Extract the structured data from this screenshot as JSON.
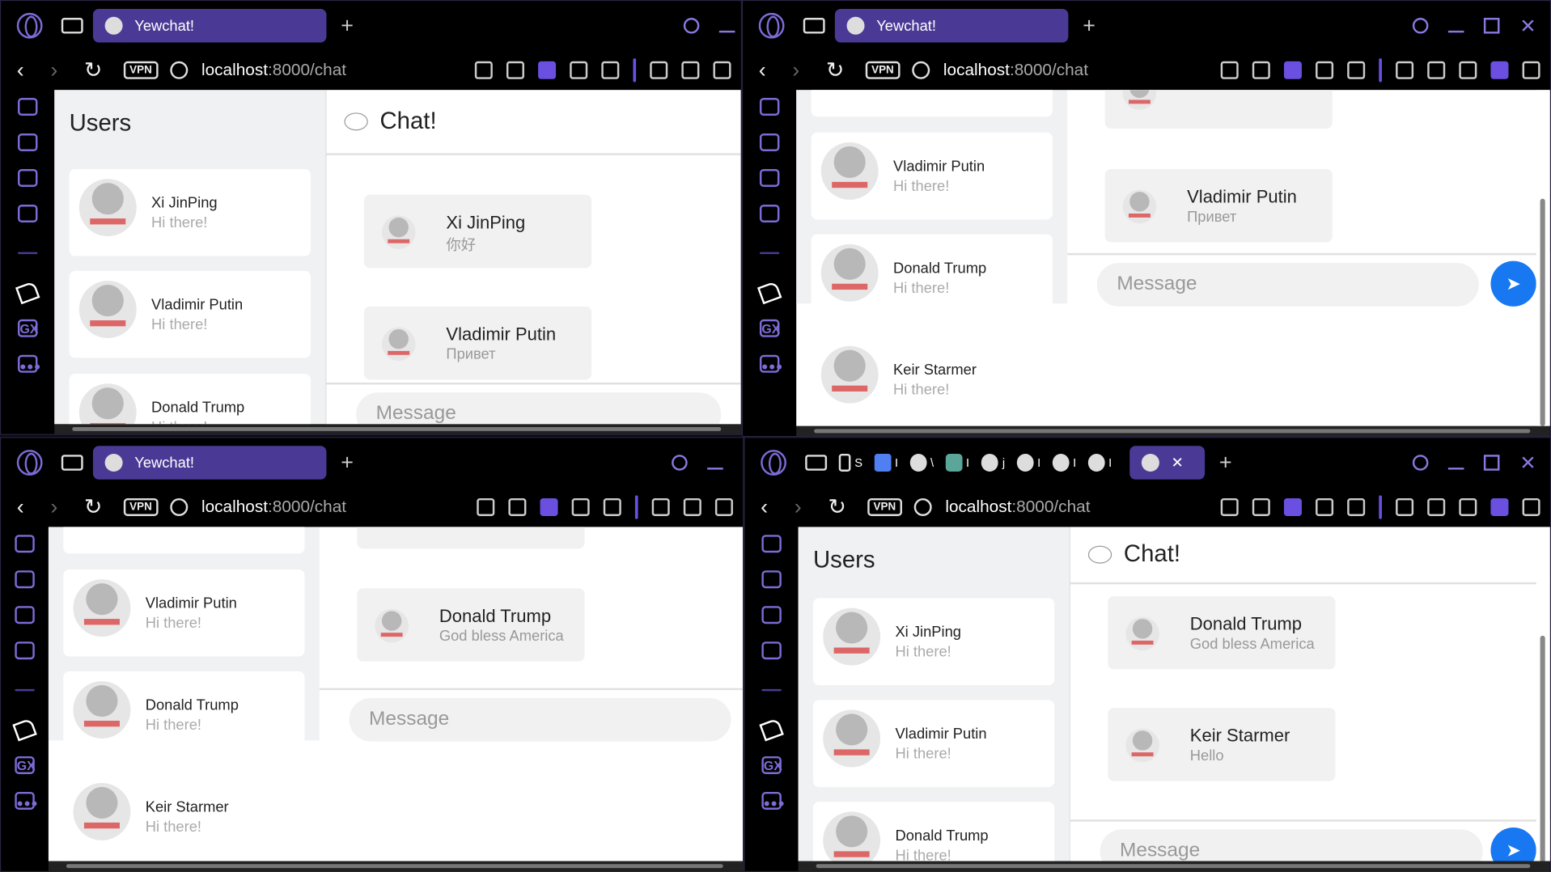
{
  "browser": {
    "tab_title": "Yewchat!",
    "url_host": "localhost",
    "url_path": ":8000/chat",
    "vpn_label": "VPN",
    "sidebar_gx": "GX",
    "sidebar_more": "•••",
    "new_tab": "+",
    "close_tab": "✕"
  },
  "app": {
    "users_heading": "Users",
    "chat_heading": "Chat!",
    "message_placeholder": "Message",
    "send_icon": "➤"
  },
  "users": [
    {
      "name": "Xi JinPing",
      "status": "Hi there!"
    },
    {
      "name": "Vladimir Putin",
      "status": "Hi there!"
    },
    {
      "name": "Donald Trump",
      "status": "Hi there!"
    },
    {
      "name": "Keir Starmer",
      "status": "Hi there!"
    }
  ],
  "messages": [
    {
      "sender": "Xi JinPing",
      "text": "你好"
    },
    {
      "sender": "Vladimir Putin",
      "text": "Привет"
    },
    {
      "sender": "Donald Trump",
      "text": "God bless America"
    },
    {
      "sender": "Keir Starmer",
      "text": "Hello"
    }
  ],
  "extra_tabs": [
    "S",
    "I",
    "\\",
    "I",
    "j",
    "I",
    "I",
    "I"
  ],
  "colors": {
    "accent": "#4a3a95",
    "send": "#1778f2",
    "sidebar_icon": "#7d6bd6"
  }
}
